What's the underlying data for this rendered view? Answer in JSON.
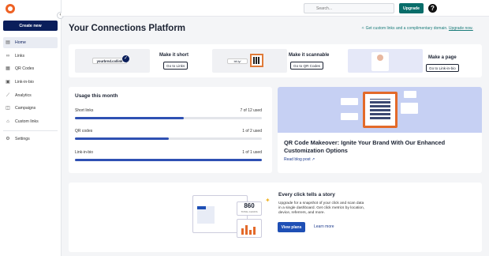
{
  "sidebar": {
    "create_label": "Create new",
    "items": [
      {
        "label": "Home",
        "icon": "home-icon"
      },
      {
        "label": "Links",
        "icon": "link-icon"
      },
      {
        "label": "QR Codes",
        "icon": "qr-icon"
      },
      {
        "label": "Link-in-bio",
        "icon": "bio-icon"
      },
      {
        "label": "Analytics",
        "icon": "analytics-icon"
      },
      {
        "label": "Campaigns",
        "icon": "campaigns-icon"
      },
      {
        "label": "Custom links",
        "icon": "custom-links-icon"
      }
    ],
    "settings_label": "Settings"
  },
  "topbar": {
    "search_placeholder": "Search...",
    "upgrade_label": "Upgrade",
    "help_label": "?"
  },
  "page": {
    "title": "Your Connections Platform",
    "promo_text": "Get custom links and a complimentary domain.",
    "promo_link": "Upgrade now."
  },
  "quick_cards": [
    {
      "title": "Make it short",
      "button": "Go to Links",
      "image_text": "yourbrnd.co/link"
    },
    {
      "title": "Make it scannable",
      "button": "Go to QR Codes",
      "image_text": "bit.ly/"
    },
    {
      "title": "Make a page",
      "button": "Go to Link-in-bio"
    }
  ],
  "usage": {
    "title": "Usage this month",
    "rows": [
      {
        "label": "Short links",
        "count": "7 of 12 used",
        "fraction": 0.583
      },
      {
        "label": "QR codes",
        "count": "1 of 2 used",
        "fraction": 0.5
      },
      {
        "label": "Link-in-bio",
        "count": "1 of 1 used",
        "fraction": 1.0
      }
    ]
  },
  "blog": {
    "title": "QR Code Makeover: Ignite Your Brand With Our Enhanced Customization Options",
    "read_label": "Read blog post"
  },
  "story": {
    "title": "Every click tells a story",
    "body": "Upgrade for a snapshot of your click and scan data in a single dashboard. Get click metrics by location, device, referrers, and more.",
    "plans_label": "View plans",
    "learn_label": "Learn more",
    "stat_value": "860",
    "stat_label": "TOTAL CLICKS"
  },
  "colors": {
    "brand_navy": "#0a1e5b",
    "teal": "#086d6a",
    "logo_orange": "#ee6123",
    "bar_blue": "#2f51b3"
  }
}
